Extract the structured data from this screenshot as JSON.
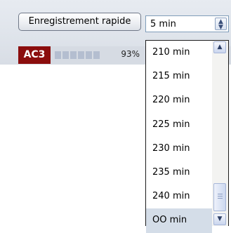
{
  "toolbar": {
    "quick_record_label": "Enregistrement rapide",
    "duration_select": {
      "selected": "5 min",
      "arrow_icon": "double-chevron-icon"
    }
  },
  "status": {
    "audio_format_badge": "AC3",
    "level_percent_label": "93%",
    "level_percent": 93
  },
  "dropdown": {
    "options": [
      {
        "label": "210 min",
        "highlighted": false
      },
      {
        "label": "215 min",
        "highlighted": false
      },
      {
        "label": "220 min",
        "highlighted": false
      },
      {
        "label": "225 min",
        "highlighted": false
      },
      {
        "label": "230 min",
        "highlighted": false
      },
      {
        "label": "235 min",
        "highlighted": false
      },
      {
        "label": "240 min",
        "highlighted": false
      },
      {
        "label": "OO min",
        "highlighted": true
      }
    ],
    "scrollbar": {
      "up_icon": "scroll-up-arrow-icon",
      "down_icon": "scroll-down-arrow-icon",
      "position": "bottom"
    }
  },
  "colors": {
    "badge_bg": "#8b0d0d",
    "highlight_bg": "#d4dde8",
    "panel_bg": "#dfe4eb"
  }
}
